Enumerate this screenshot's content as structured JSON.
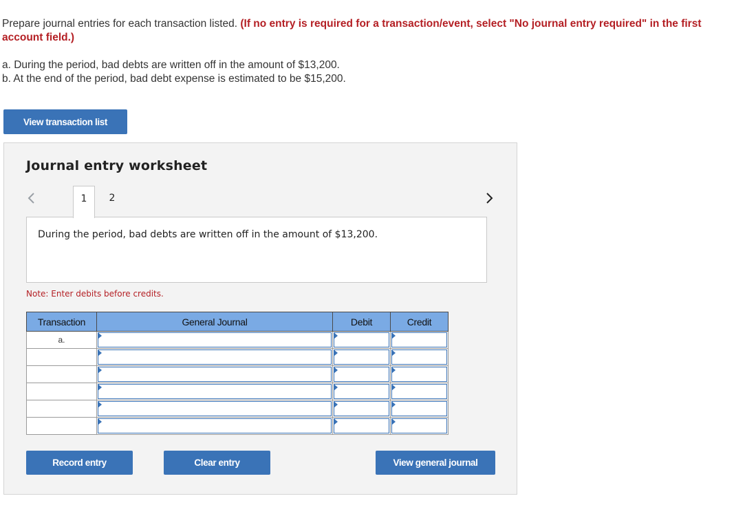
{
  "instructions": {
    "normal": "Prepare journal entries for each transaction listed.",
    "bold_red": "(If no entry is required for a transaction/event, select \"No journal entry required\" in the first account field.)"
  },
  "problems": [
    "a. During the period, bad debts are written off in the amount of $13,200.",
    "b. At the end of the period, bad debt expense is estimated to be $15,200."
  ],
  "view_list_button": "View transaction list",
  "worksheet": {
    "title": "Journal entry worksheet",
    "tabs": [
      "1",
      "2"
    ],
    "active_tab": "1",
    "description": "During the period, bad debts are written off in the amount of $13,200.",
    "note": "Note: Enter debits before credits.",
    "table": {
      "headers": [
        "Transaction",
        "General Journal",
        "Debit",
        "Credit"
      ],
      "rows": [
        {
          "transaction": "a.",
          "account": "",
          "debit": "",
          "credit": ""
        },
        {
          "transaction": "",
          "account": "",
          "debit": "",
          "credit": ""
        },
        {
          "transaction": "",
          "account": "",
          "debit": "",
          "credit": ""
        },
        {
          "transaction": "",
          "account": "",
          "debit": "",
          "credit": ""
        },
        {
          "transaction": "",
          "account": "",
          "debit": "",
          "credit": ""
        },
        {
          "transaction": "",
          "account": "",
          "debit": "",
          "credit": ""
        }
      ]
    },
    "buttons": {
      "record": "Record entry",
      "clear": "Clear entry",
      "view_journal": "View general journal"
    }
  },
  "colors": {
    "accent": "#3a73b7",
    "header_blue": "#7aaae4",
    "note_red": "#b41f24"
  },
  "icons": {
    "prev": "chevron-left-icon",
    "next": "chevron-right-icon"
  }
}
